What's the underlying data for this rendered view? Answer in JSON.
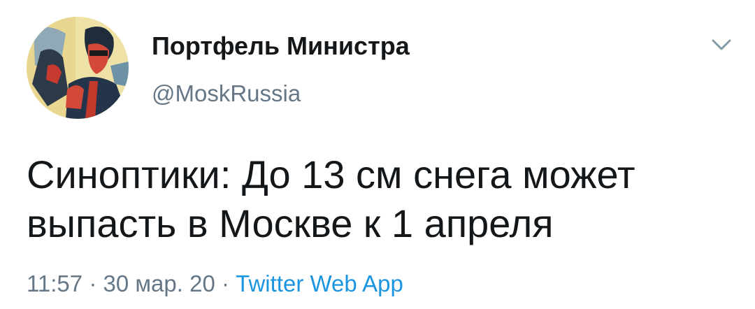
{
  "tweet": {
    "author": {
      "display_name": "Портфель Министра",
      "handle": "@MoskRussia",
      "avatar_icon": "avatar-pop-art-portrait"
    },
    "menu_icon": "chevron-down-icon",
    "text": "Синоптики: До 13 см снега может выпасть в Москве к 1 апреля",
    "time": "11:57",
    "date": "30 мар. 20",
    "separator": "·",
    "source": "Twitter Web App"
  },
  "colors": {
    "text_primary": "#14171a",
    "text_secondary": "#657786",
    "link": "#1b95e0",
    "chevron": "#8899a6"
  }
}
